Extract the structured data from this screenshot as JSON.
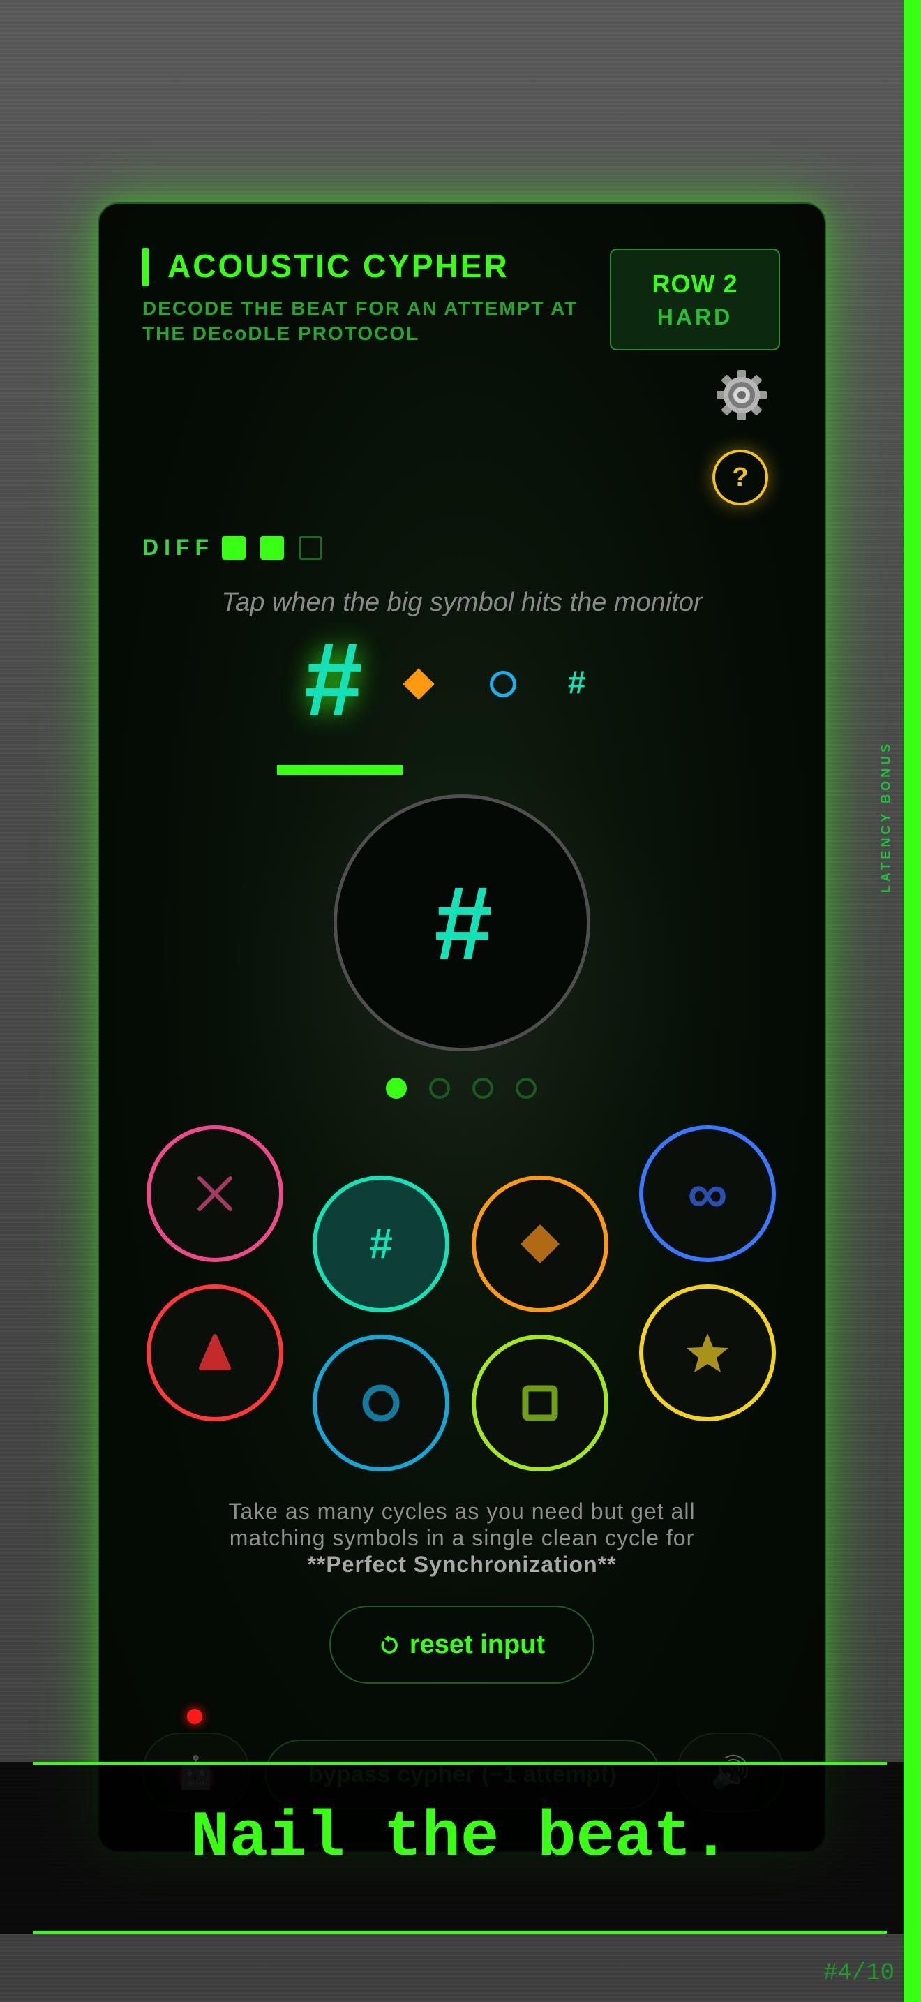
{
  "header": {
    "title": "ACOUSTIC CYPHER",
    "subtitle": "DECODE THE BEAT FOR AN ATTEMPT AT THE DEcoDLE PROTOCOL",
    "row_label": "ROW 2",
    "difficulty_label": "HARD"
  },
  "controls": {
    "settings_icon": "gear-icon",
    "help_label": "?"
  },
  "difficulty_meter": {
    "label": "DIFF",
    "filled": 2,
    "total": 3
  },
  "instruction": "Tap when the big symbol hits the monitor",
  "sequence": {
    "current_symbol": "#",
    "queue_symbols": [
      "diamond",
      "ring",
      "#"
    ],
    "monitor_symbol": "#",
    "progress_filled": 1,
    "progress_total": 4
  },
  "pads": [
    {
      "name": "cross",
      "icon": "cross-icon",
      "ring": "#ec4a88"
    },
    {
      "name": "hash",
      "icon": "hash-icon",
      "label": "#",
      "ring": "#14e2b6"
    },
    {
      "name": "diamond",
      "icon": "diamond-icon",
      "ring": "#ff9a10"
    },
    {
      "name": "infinity",
      "icon": "infinity-icon",
      "label": "∞",
      "ring": "#3a78ff"
    },
    {
      "name": "triangle",
      "icon": "triangle-icon",
      "ring": "#ff3838"
    },
    {
      "name": "ring",
      "icon": "ring-icon",
      "ring": "#16a6d6"
    },
    {
      "name": "square",
      "icon": "square-icon",
      "ring": "#a4e81c"
    },
    {
      "name": "star",
      "icon": "star-icon",
      "ring": "#f2d41a"
    }
  ],
  "note": {
    "line1": "Take as many cycles as you need but get all",
    "line2": "matching symbols in a single clean cycle for",
    "line3": "**Perfect Synchronization**"
  },
  "reset_label": "reset input",
  "bypass_label": "bypass cypher (−1 attempt)",
  "side_label": "LATENCY BONUS",
  "banner_text": "Nail the beat.",
  "page_counter": "#4/10",
  "colors": {
    "accent": "#39ff14",
    "teal": "#14e2b6",
    "warning": "#f2c417"
  }
}
